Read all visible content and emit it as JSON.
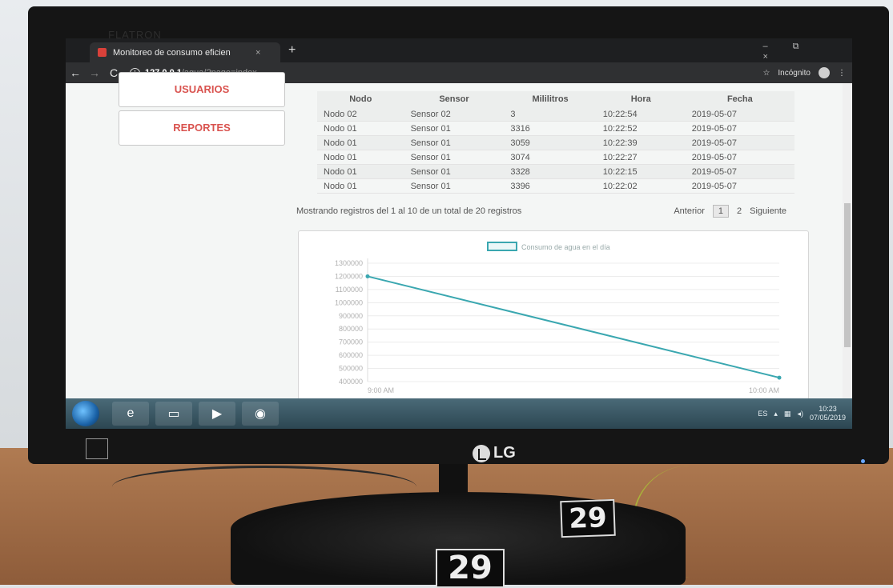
{
  "monitor": {
    "brand": "LG",
    "model_label": "FLATRON"
  },
  "stickers": [
    "29",
    "29"
  ],
  "browser": {
    "tab_title": "Monitoreo de consumo eficien",
    "tab_close": "×",
    "new_tab": "+",
    "url_host": "127.0.0.1",
    "url_path": "/agua/?page=index",
    "incognito_label": "Incógnito",
    "star": "☆",
    "window_controls": "– ⧉ ×"
  },
  "sidebar": {
    "users_label": "USUARIOS",
    "reports_label": "REPORTES"
  },
  "table": {
    "columns": [
      "Nodo",
      "Sensor",
      "Mililitros",
      "Hora",
      "Fecha"
    ],
    "rows": [
      [
        "Nodo 02",
        "Sensor 02",
        "3",
        "10:22:54",
        "2019-05-07"
      ],
      [
        "Nodo 01",
        "Sensor 01",
        "3316",
        "10:22:52",
        "2019-05-07"
      ],
      [
        "Nodo 01",
        "Sensor 01",
        "3059",
        "10:22:39",
        "2019-05-07"
      ],
      [
        "Nodo 01",
        "Sensor 01",
        "3074",
        "10:22:27",
        "2019-05-07"
      ],
      [
        "Nodo 01",
        "Sensor 01",
        "3328",
        "10:22:15",
        "2019-05-07"
      ],
      [
        "Nodo 01",
        "Sensor 01",
        "3396",
        "10:22:02",
        "2019-05-07"
      ]
    ],
    "footer_info": "Mostrando registros del 1 al 10 de un total de 20 registros",
    "pager_prev": "Anterior",
    "pager_page1": "1",
    "pager_page2": "2",
    "pager_next": "Siguiente"
  },
  "chart_data": {
    "type": "line",
    "legend": "Consumo de agua en el día",
    "x": [
      "9:00 AM",
      "10:00 AM"
    ],
    "series": [
      {
        "name": "Consumo de agua en el día",
        "values": [
          1200000,
          430000
        ],
        "color": "#3aa7b0"
      }
    ],
    "yticks": [
      1300000,
      1200000,
      1100000,
      1000000,
      900000,
      800000,
      700000,
      600000,
      500000,
      400000
    ],
    "ylim": [
      400000,
      1300000
    ],
    "grid": true,
    "legend_position": "top-center"
  },
  "taskbar": {
    "tray_lang": "ES",
    "clock_time": "10:23",
    "clock_date": "07/05/2019"
  }
}
